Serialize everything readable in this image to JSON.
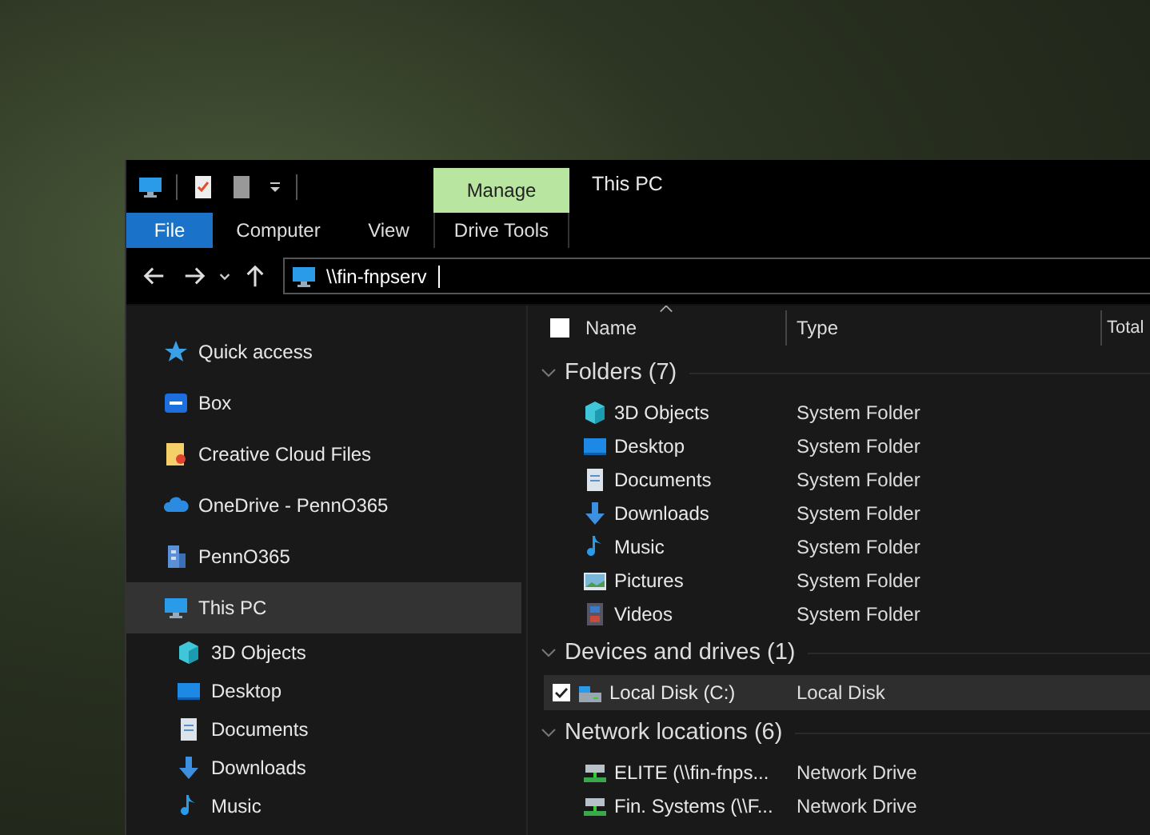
{
  "window": {
    "title": "This PC"
  },
  "ribbon": {
    "context_label": "Manage",
    "tabs": [
      {
        "label": "File",
        "kind": "file",
        "selected": false
      },
      {
        "label": "Computer",
        "kind": "tab",
        "selected": false
      },
      {
        "label": "View",
        "kind": "tab",
        "selected": false
      },
      {
        "label": "Drive Tools",
        "kind": "context",
        "selected": false
      }
    ]
  },
  "address_bar": {
    "value": "\\\\fin-fnpserv"
  },
  "sidebar": {
    "items": [
      {
        "label": "Quick access",
        "selected": false
      },
      {
        "label": "Box",
        "selected": false
      },
      {
        "label": "Creative Cloud Files",
        "selected": false
      },
      {
        "label": "OneDrive - PennO365",
        "selected": false
      },
      {
        "label": "PennO365",
        "selected": false
      },
      {
        "label": "This PC",
        "selected": true,
        "children": [
          {
            "label": "3D Objects",
            "selected": false
          },
          {
            "label": "Desktop",
            "selected": false
          },
          {
            "label": "Documents",
            "selected": false
          },
          {
            "label": "Downloads",
            "selected": false
          },
          {
            "label": "Music",
            "selected": false
          }
        ]
      }
    ]
  },
  "table": {
    "select_all": {
      "checked": false
    },
    "columns": [
      "Name",
      "Type",
      "Total"
    ],
    "groups": [
      {
        "title": "Folders (7)",
        "expanded": true,
        "rows": [
          {
            "name": "3D Objects",
            "type": "System Folder",
            "selected": false
          },
          {
            "name": "Desktop",
            "type": "System Folder",
            "selected": false
          },
          {
            "name": "Documents",
            "type": "System Folder",
            "selected": false
          },
          {
            "name": "Downloads",
            "type": "System Folder",
            "selected": false
          },
          {
            "name": "Music",
            "type": "System Folder",
            "selected": false
          },
          {
            "name": "Pictures",
            "type": "System Folder",
            "selected": false
          },
          {
            "name": "Videos",
            "type": "System Folder",
            "selected": false
          }
        ]
      },
      {
        "title": "Devices and drives (1)",
        "expanded": true,
        "rows": [
          {
            "name": "Local Disk (C:)",
            "type": "Local Disk",
            "selected": true
          }
        ]
      },
      {
        "title": "Network locations (6)",
        "expanded": true,
        "rows": [
          {
            "name": "ELITE (\\\\fin-fnps...",
            "type": "Network Drive",
            "selected": false
          },
          {
            "name": "Fin. Systems (\\\\F...",
            "type": "Network Drive",
            "selected": false
          }
        ]
      }
    ]
  }
}
